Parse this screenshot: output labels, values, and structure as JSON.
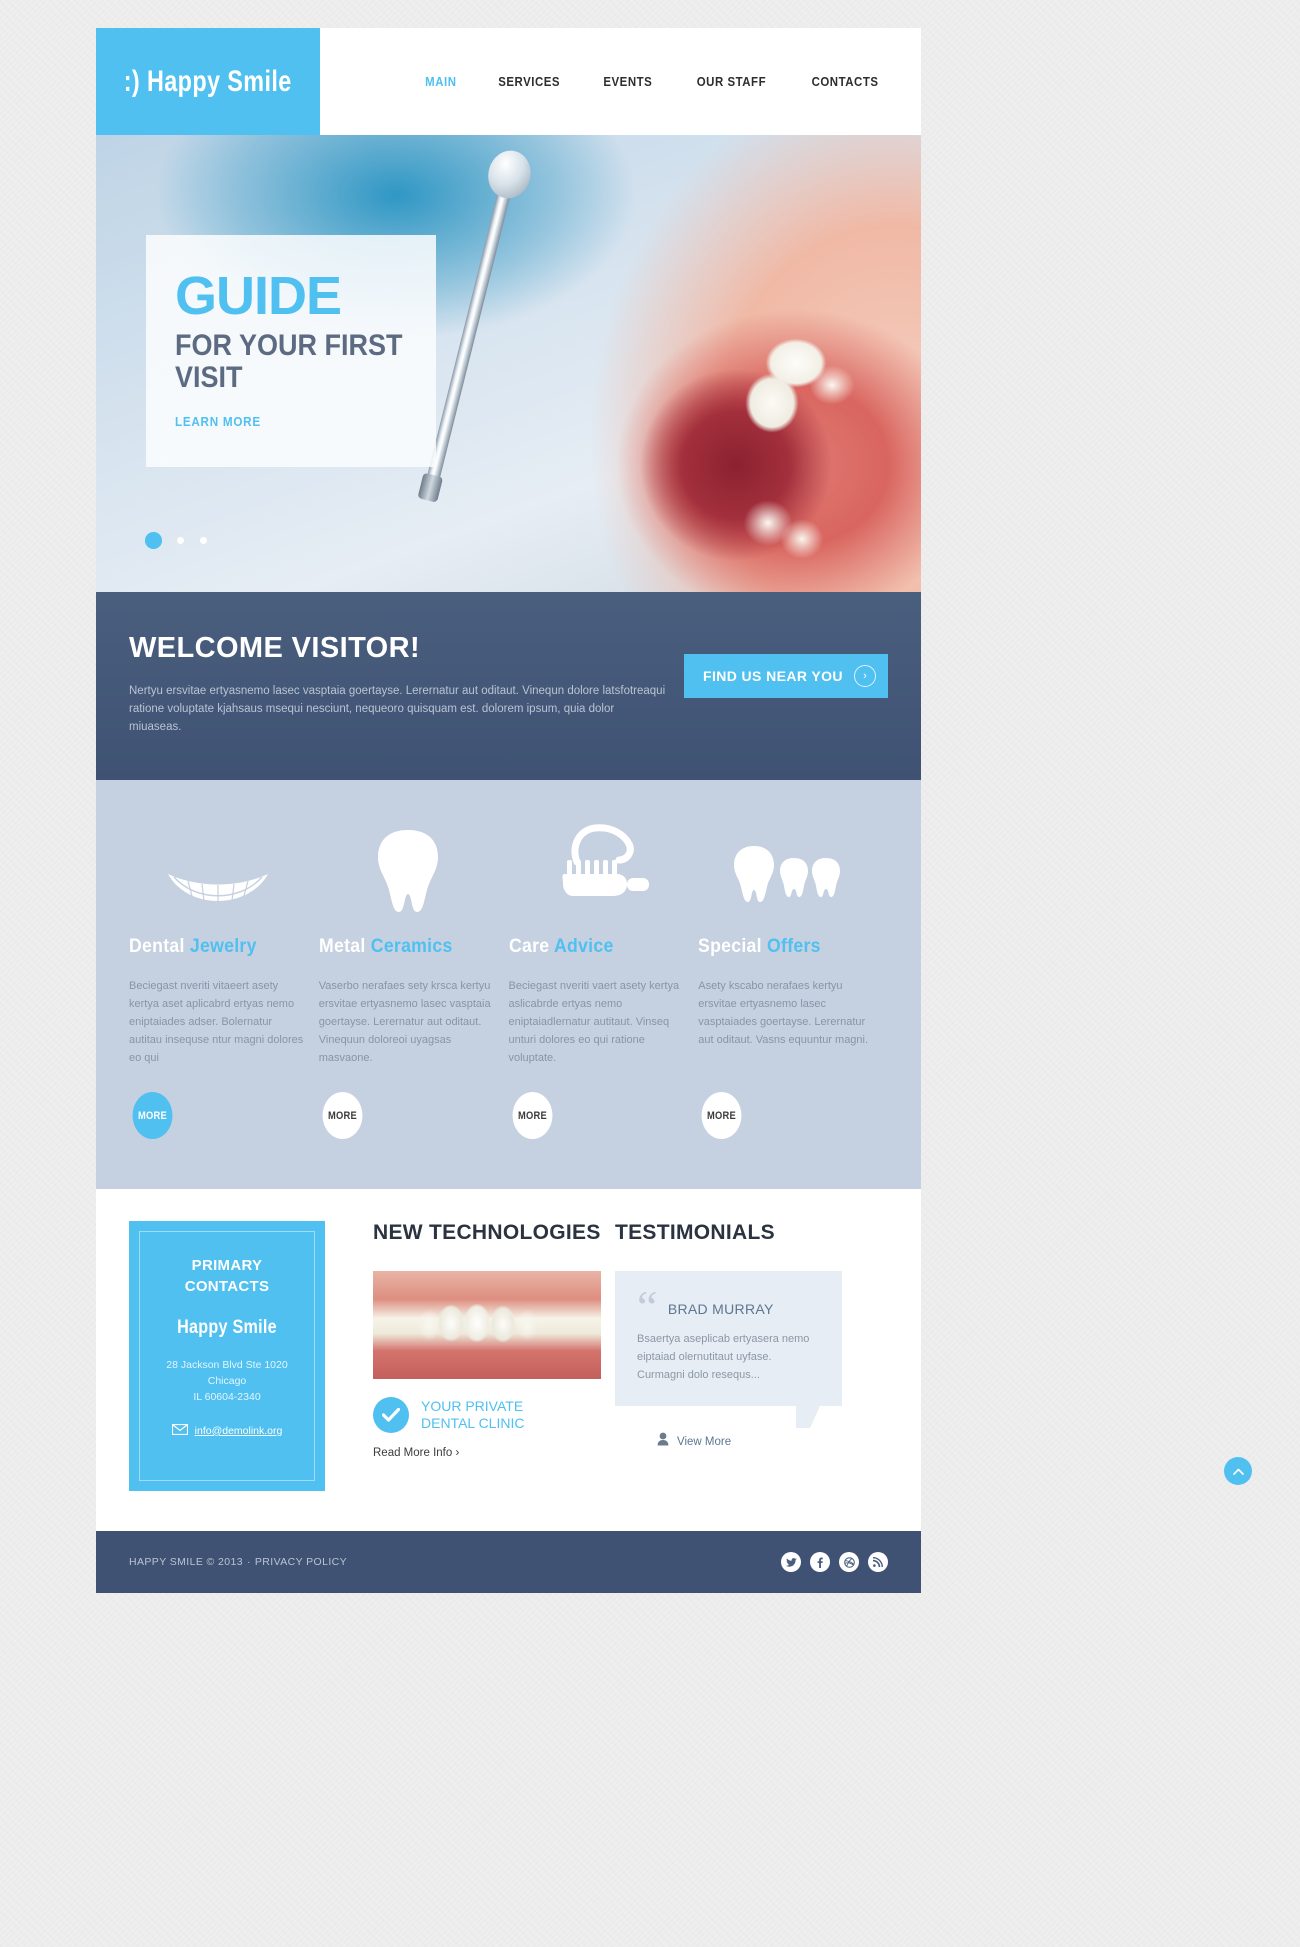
{
  "brand": {
    "logo": ":) Happy Smile"
  },
  "nav": {
    "items": [
      {
        "label": "MAIN",
        "active": true
      },
      {
        "label": "SERVICES",
        "active": false
      },
      {
        "label": "EVENTS",
        "active": false
      },
      {
        "label": "OUR STAFF",
        "active": false
      },
      {
        "label": "CONTACTS",
        "active": false
      }
    ]
  },
  "slider": {
    "caption_title": "GUIDE",
    "caption_sub": "FOR YOUR FIRST VISIT",
    "caption_link": "LEARN MORE",
    "dots": [
      true,
      false,
      false
    ]
  },
  "welcome": {
    "title": "WELCOME VISITOR!",
    "text": "Nertyu ersvitae ertyasnemo lasec vasptaia goertayse. Lerernatur aut oditaut. Vinequn dolore latsfotreaqui ratione voluptate kjahsaus msequi nesciunt, nequeoro quisquam est. dolorem ipsum, quia dolor miuaseas.",
    "button_label": "FIND US NEAR YOU",
    "button_arrow": "›"
  },
  "services": {
    "more_label": "MORE",
    "items": [
      {
        "icon": "smile-icon",
        "title_white": "Dental",
        "title_accent": "Jewelry",
        "text": "Beciegast nveriti vitaeert asety kertya aset aplicabrd  ertyas nemo eniptaiades adser. Bolernatur autitau insequse ntur magni dolores eo qui",
        "active": true
      },
      {
        "icon": "tooth-icon",
        "title_white": "Metal",
        "title_accent": "Ceramics",
        "text": "Vaserbo nerafaes sety krsca kertyu ersvitae ertyasnemo lasec vasptaia goertayse. Lerernatur aut oditaut. Vinequun doloreoi uyagsas masvaone.",
        "active": false
      },
      {
        "icon": "toothbrush-icon",
        "title_white": "Care",
        "title_accent": "Advice",
        "text": "Beciegast nveriti vaert asety kertya aslicabrde ertyas nemo eniptaiadlernatur autitaut. Vinseq unturi dolores eo qui ratione voluptate.",
        "active": false
      },
      {
        "icon": "three-teeth-icon",
        "title_white": "Special",
        "title_accent": "Offers",
        "text": "Asety kscabo nerafaes kertyu ersvitae ertyasnemo lasec vasptaiades goertayse. Lerernatur aut oditaut. Vasns equuntur magni.",
        "active": false
      }
    ]
  },
  "contacts": {
    "title": "PRIMARY CONTACTS",
    "brand": "Happy Smile",
    "address_line1": "28 Jackson Blvd Ste 1020",
    "address_line2": "Chicago",
    "address_line3": "IL 60604-2340",
    "email": "info@demolink.org"
  },
  "technologies": {
    "heading": "NEW TECHNOLOGIES",
    "caption_line1": "YOUR PRIVATE",
    "caption_line2": "DENTAL CLINIC",
    "read_more": "Read More Info  ›"
  },
  "testimonials": {
    "heading": "TESTIMONIALS",
    "quote_mark": "“",
    "author": "BRAD MURRAY",
    "text": "Bsaertya aseplicab ertyasera nemo eiptaiad olernutitaut uyfase. Curmagni dolo resequs...",
    "view_more": "View More"
  },
  "footer": {
    "copyright": "HAPPY SMILE © 2013",
    "separator": "·",
    "privacy": "PRIVACY POLICY",
    "socials": [
      "twitter-icon",
      "facebook-icon",
      "dribbble-icon",
      "rss-icon"
    ]
  },
  "to_top": {
    "icon": "chevron-up-icon"
  },
  "colors": {
    "accent": "#4fc0f0",
    "dark": "#3f5273",
    "services_bg": "#c5d0e0"
  }
}
